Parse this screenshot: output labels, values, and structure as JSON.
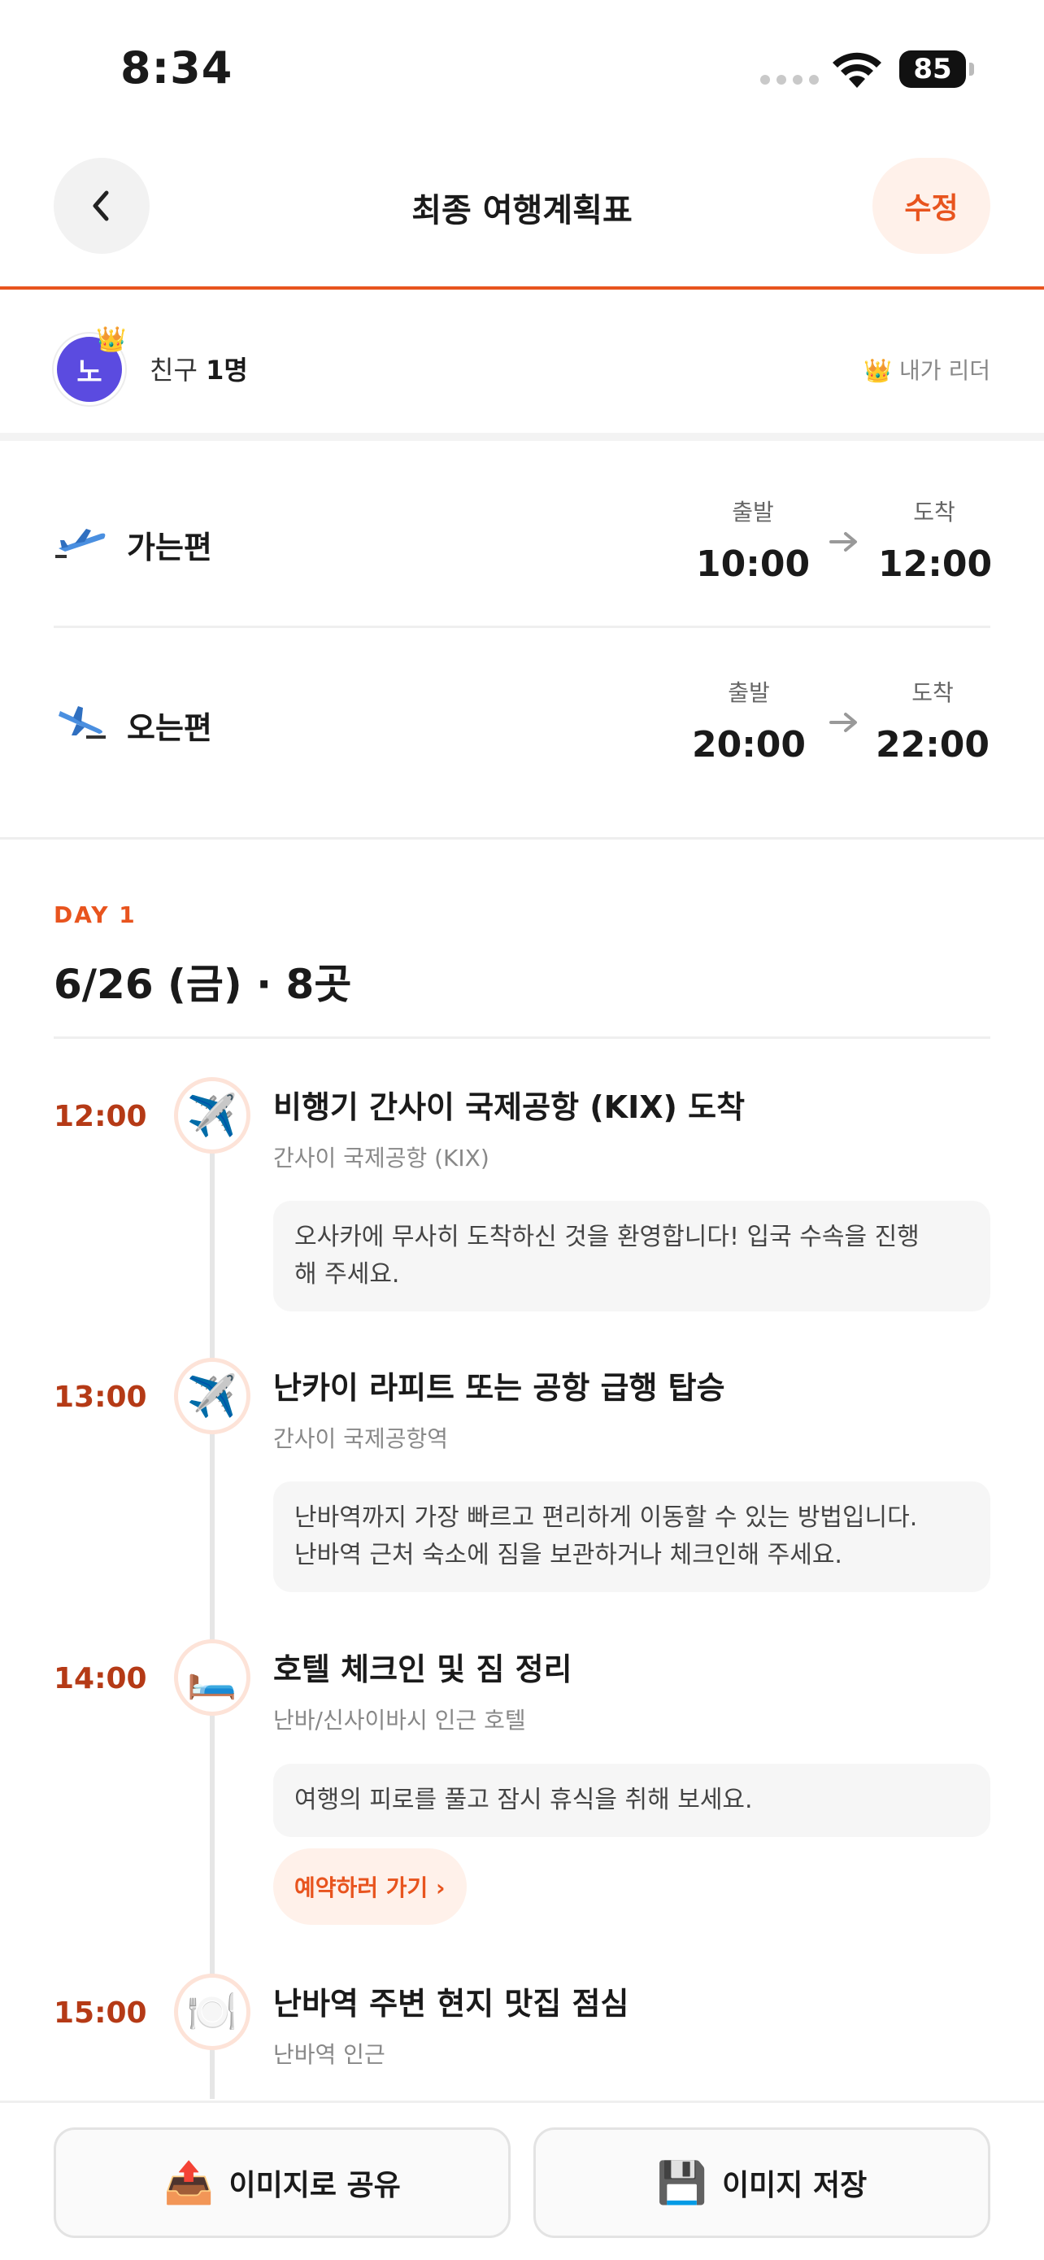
{
  "status_bar": {
    "time": "8:34",
    "battery": "85"
  },
  "header": {
    "title": "최종 여행계획표",
    "edit_label": "수정"
  },
  "members": {
    "avatar_initial": "노",
    "friends_prefix": "친구 ",
    "friends_count": "1명",
    "leader_label": "👑 내가 리더"
  },
  "flights": {
    "outbound": {
      "label": "가는편",
      "depart_caption": "출발",
      "depart_time": "10:00",
      "arrive_caption": "도착",
      "arrive_time": "12:00"
    },
    "inbound": {
      "label": "오는편",
      "depart_caption": "출발",
      "depart_time": "20:00",
      "arrive_caption": "도착",
      "arrive_time": "22:00"
    }
  },
  "day": {
    "label": "DAY 1",
    "title": "6/26 (금) · 8곳"
  },
  "timeline": [
    {
      "time": "12:00",
      "icon": "✈️",
      "title": "비행기 간사이 국제공항 (KIX) 도착",
      "subtitle": "간사이 국제공항 (KIX)",
      "note_line1": "오사카에 무사히 도착하신 것을 환영합니다! 입국 수속을 진행",
      "note_line2": "해 주세요."
    },
    {
      "time": "13:00",
      "icon": "✈️",
      "title": "난카이 라피트 또는 공항 급행 탑승",
      "subtitle": "간사이 국제공항역",
      "note_line1": "난바역까지 가장 빠르고 편리하게 이동할 수 있는 방법입니다.",
      "note_line2": "난바역 근처 숙소에 짐을 보관하거나 체크인해 주세요."
    },
    {
      "time": "14:00",
      "icon": "🛏️",
      "title": "호텔 체크인 및 짐 정리",
      "subtitle": "난바/신사이바시 인근 호텔",
      "note_line1": "여행의 피로를 풀고 잠시 휴식을 취해 보세요.",
      "action": "예약하러 가기 ›"
    },
    {
      "time": "15:00",
      "icon": "🍽️",
      "title": "난바역 주변 현지 맛집 점심",
      "subtitle": "난바역 인근"
    }
  ],
  "bottom": {
    "share_icon": "📤",
    "share_label": "이미지로 공유",
    "save_icon": "💾",
    "save_label": "이미지 저장"
  },
  "colors": {
    "accent": "#e8541e",
    "time_text": "#b53a16",
    "avatar": "#5b4be0"
  }
}
